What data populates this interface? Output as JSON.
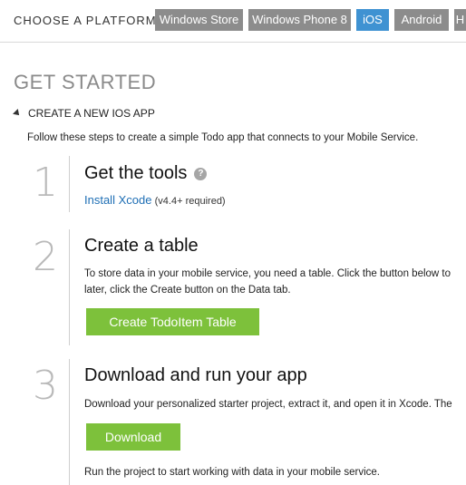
{
  "platform": {
    "label": "CHOOSE A PLATFORM",
    "tabs": [
      {
        "label": "Windows Store",
        "active": false
      },
      {
        "label": "Windows Phone 8",
        "active": false
      },
      {
        "label": "iOS",
        "active": true
      },
      {
        "label": "Android",
        "active": false
      },
      {
        "label": "H",
        "active": false
      }
    ]
  },
  "page": {
    "heading": "GET STARTED",
    "section": "CREATE A NEW IOS APP",
    "intro": "Follow these steps to create a simple Todo app that connects to your Mobile Service."
  },
  "steps": [
    {
      "number": "1",
      "title": "Get the tools",
      "link": "Install Xcode",
      "note": "(v4.4+ required)"
    },
    {
      "number": "2",
      "title": "Create a table",
      "line1": "To store data in your mobile service, you need a table. Click the button below to",
      "line2": "later, click the Create button on the Data tab.",
      "button": "Create TodoItem Table"
    },
    {
      "number": "3",
      "title": "Download and run your app",
      "line1": "Download your personalized starter project, extract it, and open it in Xcode. The",
      "button": "Download",
      "line2": "Run the project to start working with data in your mobile service."
    }
  ],
  "colors": {
    "tab_inactive": "#8c8c8c",
    "tab_active": "#3f92d2",
    "button_green": "#7dc13b",
    "link_blue": "#1f6fb5"
  },
  "icons": {
    "help": "question-circle-icon",
    "collapse": "triangle-down-icon"
  }
}
